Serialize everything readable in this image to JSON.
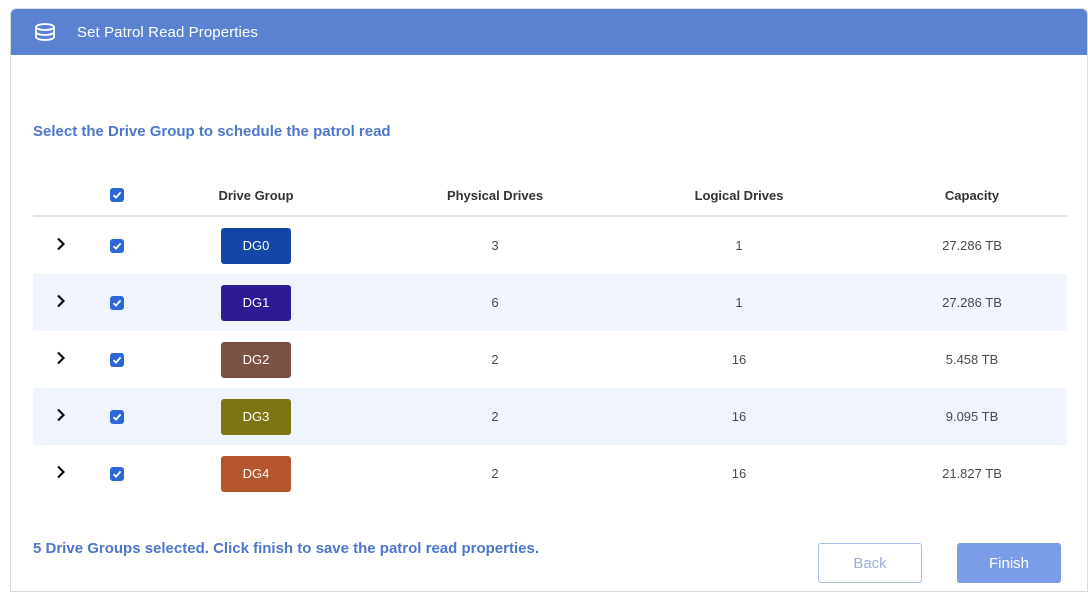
{
  "dialog": {
    "title": "Set Patrol Read Properties",
    "title_icon": "database-icon"
  },
  "instruction": "Select the Drive Group to schedule the patrol read",
  "table": {
    "header_select_all": true,
    "columns": [
      "Drive Group",
      "Physical Drives",
      "Logical Drives",
      "Capacity"
    ],
    "rows": [
      {
        "name": "DG0",
        "color": "#1346a8",
        "physical": "3",
        "logical": "1",
        "capacity": "27.286 TB",
        "checked": true
      },
      {
        "name": "DG1",
        "color": "#2d1a95",
        "physical": "6",
        "logical": "1",
        "capacity": "27.286 TB",
        "checked": true
      },
      {
        "name": "DG2",
        "color": "#7b5144",
        "physical": "2",
        "logical": "16",
        "capacity": "5.458 TB",
        "checked": true
      },
      {
        "name": "DG3",
        "color": "#7d7414",
        "physical": "2",
        "logical": "16",
        "capacity": "9.095 TB",
        "checked": true
      },
      {
        "name": "DG4",
        "color": "#b5562f",
        "physical": "2",
        "logical": "16",
        "capacity": "21.827 TB",
        "checked": true
      }
    ]
  },
  "footer": {
    "message": "5 Drive Groups selected. Click finish to save the patrol read properties.",
    "back_label": "Back",
    "finish_label": "Finish"
  }
}
